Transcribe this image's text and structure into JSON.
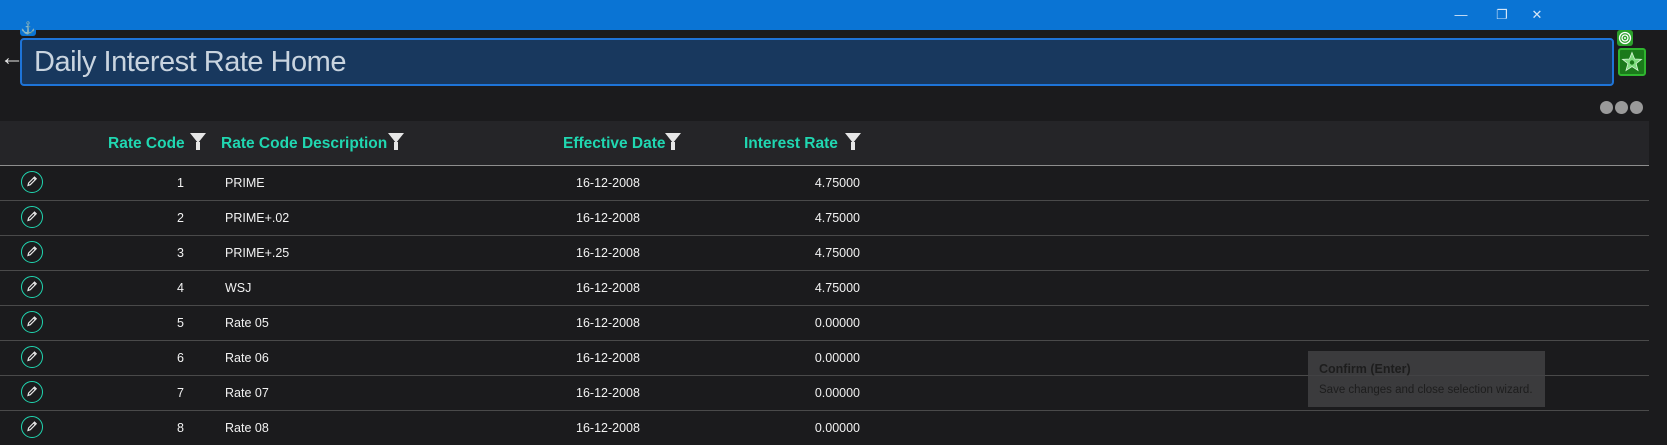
{
  "window": {
    "minimize_glyph": "—",
    "restore_glyph": "❐",
    "close_glyph": "✕"
  },
  "header": {
    "title": "Daily Interest Rate Home",
    "anchor_glyph": "⚓",
    "back_glyph": "←"
  },
  "grid": {
    "columns": [
      {
        "key": "rate_code",
        "label": "Rate Code"
      },
      {
        "key": "description",
        "label": "Rate Code Description"
      },
      {
        "key": "effective_date",
        "label": "Effective Date"
      },
      {
        "key": "interest_rate",
        "label": "Interest Rate"
      }
    ],
    "rows": [
      {
        "rate_code": "1",
        "description": "PRIME",
        "effective_date": "16-12-2008",
        "interest_rate": "4.75000"
      },
      {
        "rate_code": "2",
        "description": "PRIME+.02",
        "effective_date": "16-12-2008",
        "interest_rate": "4.75000"
      },
      {
        "rate_code": "3",
        "description": "PRIME+.25",
        "effective_date": "16-12-2008",
        "interest_rate": "4.75000"
      },
      {
        "rate_code": "4",
        "description": "WSJ",
        "effective_date": "16-12-2008",
        "interest_rate": "4.75000"
      },
      {
        "rate_code": "5",
        "description": "Rate 05",
        "effective_date": "16-12-2008",
        "interest_rate": "0.00000"
      },
      {
        "rate_code": "6",
        "description": "Rate 06",
        "effective_date": "16-12-2008",
        "interest_rate": "0.00000"
      },
      {
        "rate_code": "7",
        "description": "Rate 07",
        "effective_date": "16-12-2008",
        "interest_rate": "0.00000"
      },
      {
        "rate_code": "8",
        "description": "Rate 08",
        "effective_date": "16-12-2008",
        "interest_rate": "0.00000"
      }
    ]
  },
  "tooltip": {
    "title": "Confirm (Enter)",
    "text": "Save changes and close selection wizard."
  },
  "colors": {
    "accent": "#20d7b1",
    "titlebar": "#0a74d4",
    "background": "#1b1b1d"
  },
  "icons": [
    "anchor-icon",
    "back-arrow-icon",
    "target-icon",
    "star-icon",
    "more-options-icon",
    "filter-icon",
    "edit-pencil-icon"
  ]
}
